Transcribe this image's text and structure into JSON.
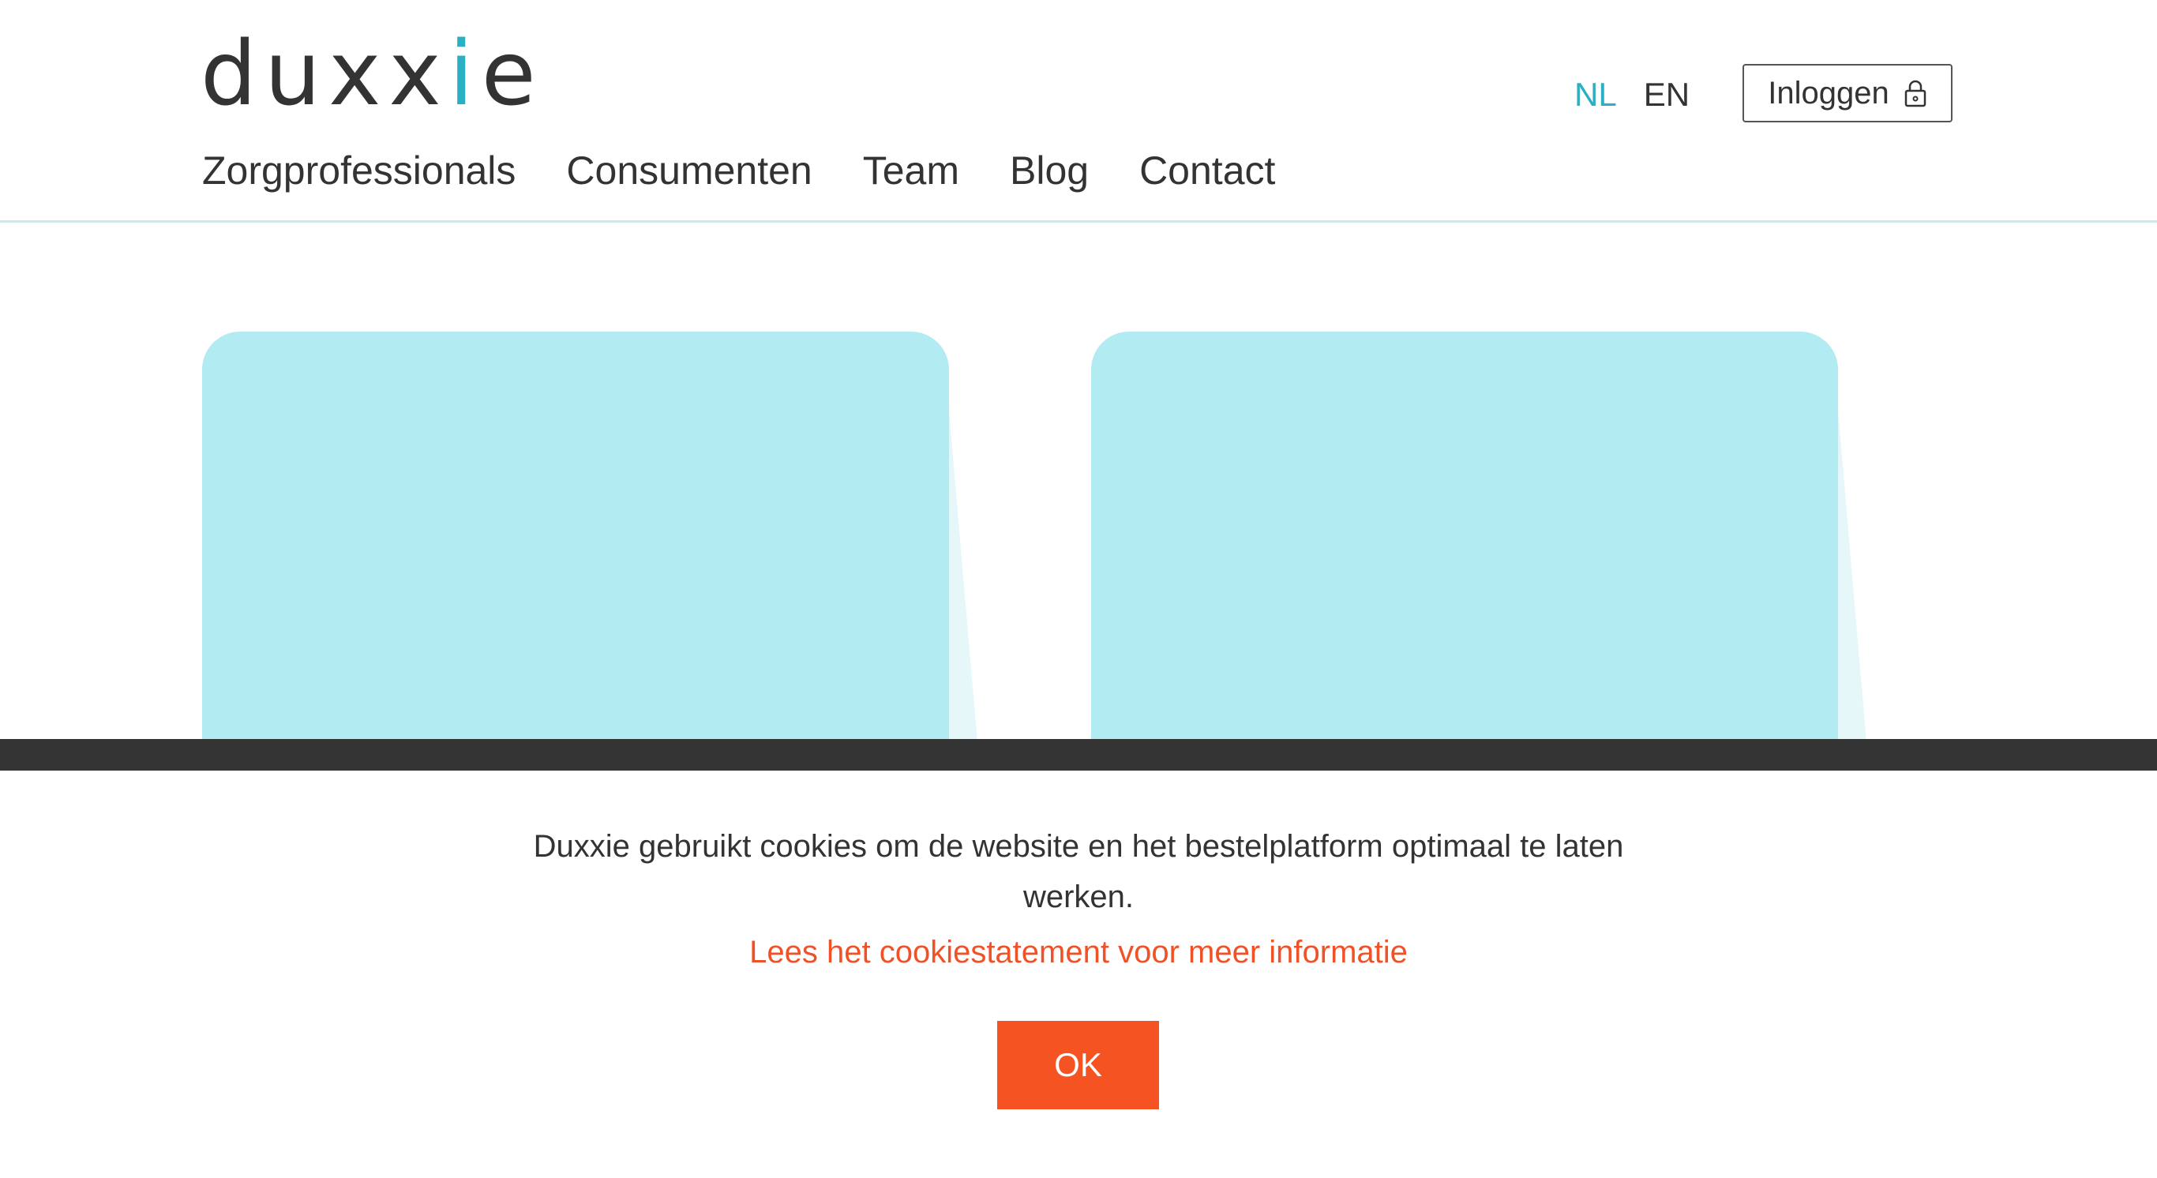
{
  "brand": {
    "logo_text_start": "dux",
    "logo_text_x": "x",
    "logo_text_i": "i",
    "logo_text_end": "e",
    "accent_color": "#2ab0c2"
  },
  "nav": {
    "items": [
      {
        "label": "Zorgprofessionals"
      },
      {
        "label": "Consumenten"
      },
      {
        "label": "Team"
      },
      {
        "label": "Blog"
      },
      {
        "label": "Contact"
      }
    ]
  },
  "language": {
    "options": [
      {
        "label": "NL",
        "active": true
      },
      {
        "label": "EN",
        "active": false
      }
    ]
  },
  "login": {
    "label": "Inloggen",
    "icon": "lock-icon"
  },
  "cards": [
    {
      "color": "#b3ebf2"
    },
    {
      "color": "#b3ebf2"
    }
  ],
  "cookie": {
    "message": "Duxxie gebruikt cookies om de website en het bestelplatform optimaal te laten werken.",
    "link_text": "Lees het cookiestatement voor meer informatie",
    "button_label": "OK",
    "link_color": "#f05228",
    "button_color": "#f55322",
    "bar_color": "#333333"
  }
}
